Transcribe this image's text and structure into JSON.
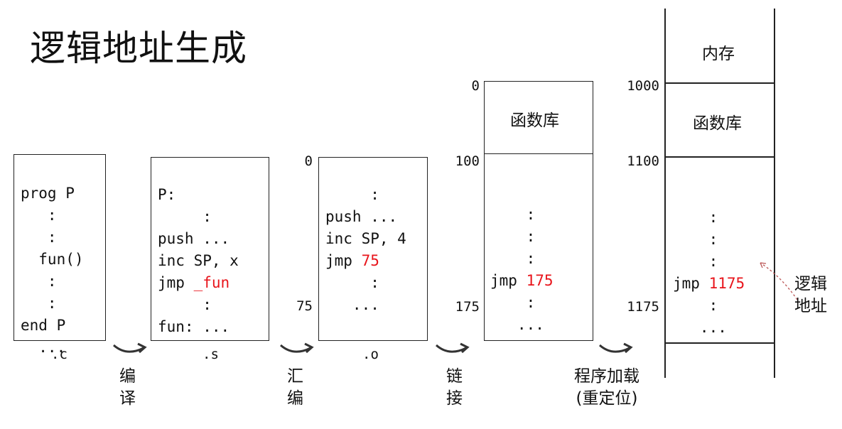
{
  "title": "逻辑地址生成",
  "c_file": {
    "lines": [
      "prog P",
      "   :",
      "   :",
      "  fun()",
      "   :",
      "   :",
      "end P",
      "  ..."
    ],
    "label": ".c"
  },
  "s_file": {
    "lines": [
      "P:",
      "     :",
      "push ...",
      "inc SP, x",
      "jmp ",
      "     :",
      "fun: ..."
    ],
    "jmp_target": "_fun",
    "label": ".s"
  },
  "o_file": {
    "lines": [
      "",
      "     :",
      "push ...",
      "inc SP, 4",
      "jmp ",
      "     :",
      "   ..."
    ],
    "jmp_target": "75",
    "label": ".o",
    "addr_top": "0",
    "addr_mid": "75"
  },
  "linked": {
    "lib_label": "函数库",
    "addr_top": "0",
    "addr_100": "100",
    "addr_175": "175",
    "lines": [
      "    :",
      "    :",
      "    :",
      "jmp ",
      "    :",
      "   ..."
    ],
    "jmp_target": "175"
  },
  "memory": {
    "top_label": "内存",
    "lib_label": "函数库",
    "addr_1000": "1000",
    "addr_1100": "1100",
    "addr_1175": "1175",
    "lines": [
      "    :",
      "    :",
      "    :",
      "jmp ",
      "    :",
      "   ..."
    ],
    "jmp_target": "1175",
    "annotation": [
      "逻辑",
      "地址"
    ]
  },
  "steps": {
    "compile": [
      "编",
      "译"
    ],
    "assemble": [
      "汇",
      "编"
    ],
    "link": [
      "链",
      "接"
    ],
    "load": [
      "程序加载",
      "(重定位)"
    ]
  },
  "colors": {
    "highlight": "#e8141b",
    "stroke": "#222222"
  }
}
